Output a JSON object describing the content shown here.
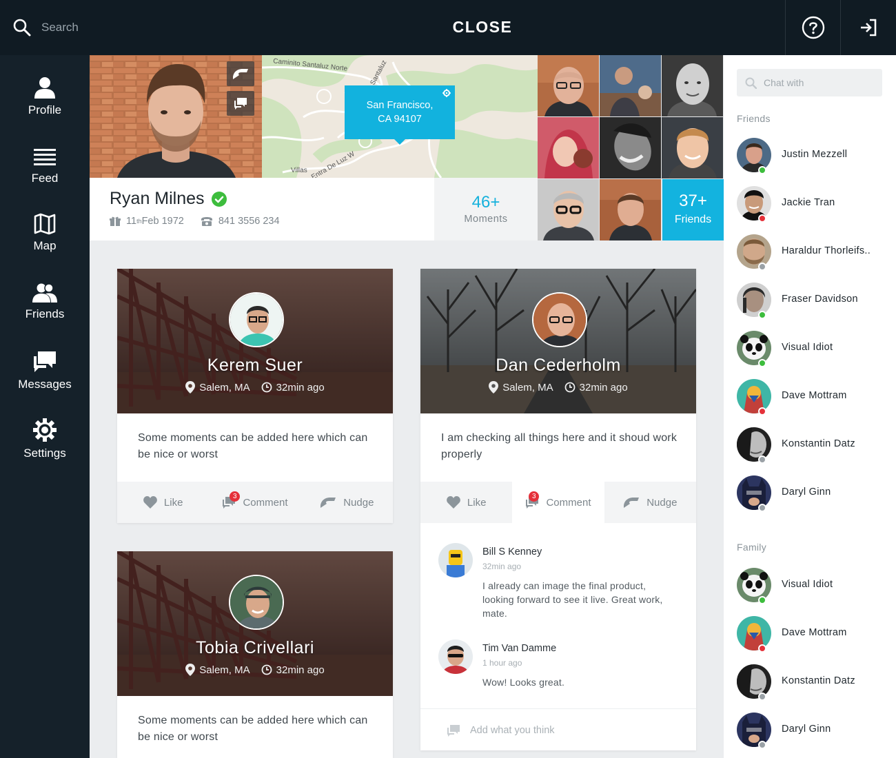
{
  "topbar": {
    "search_placeholder": "Search",
    "title": "CLOSE",
    "help_icon": "question-circle-icon",
    "logout_icon": "sign-out-icon"
  },
  "sidebar": {
    "items": [
      {
        "label": "Profile",
        "icon": "user-icon"
      },
      {
        "label": "Feed",
        "icon": "list-icon"
      },
      {
        "label": "Map",
        "icon": "map-icon"
      },
      {
        "label": "Friends",
        "icon": "users-icon"
      },
      {
        "label": "Messages",
        "icon": "chat-icon"
      },
      {
        "label": "Settings",
        "icon": "gear-icon"
      }
    ]
  },
  "map": {
    "location_line1": "San Francisco,",
    "location_line2": "CA 94107",
    "street_labels": [
      "Caminito Santaluz Norte",
      "Santaluz",
      "Villas",
      "Entra De Luz W"
    ]
  },
  "profile": {
    "name": "Ryan Milnes",
    "birthday_day": "11",
    "birthday_suffix": "th",
    "birthday_rest": " Feb 1972",
    "phone": "841 3556 234",
    "moments_count": "46+",
    "moments_label": "Moments",
    "friends_count": "37+",
    "friends_label": "Friends"
  },
  "cards": [
    {
      "name": "Kerem Suer",
      "location": "Salem, MA",
      "time": "32min ago",
      "text": "Some moments can be added here which can be nice or worst",
      "actions": {
        "like": "Like",
        "comment": "Comment",
        "comment_count": "3",
        "nudge": "Nudge"
      }
    },
    {
      "name": "Dan Cederholm",
      "location": "Salem, MA",
      "time": "32min ago",
      "text": "I am checking all things here and it shoud work properly",
      "actions": {
        "like": "Like",
        "comment": "Comment",
        "comment_count": "3",
        "nudge": "Nudge"
      },
      "comments": [
        {
          "name": "Bill S Kenney",
          "time": "32min ago",
          "text": "I already can image the final product, looking forward to see it live. Great work, mate."
        },
        {
          "name": "Tim Van Damme",
          "time": "1 hour ago",
          "text": "Wow! Looks great."
        }
      ],
      "add_placeholder": "Add what you think"
    },
    {
      "name": "Tobia Crivellari",
      "location": "Salem, MA",
      "time": "32min ago",
      "text": "Some moments can be added here which can be nice or worst"
    }
  ],
  "chat": {
    "search_placeholder": "Chat with",
    "friends_label": "Friends",
    "family_label": "Family",
    "friends": [
      {
        "name": "Justin Mezzell",
        "status": "online"
      },
      {
        "name": "Jackie Tran",
        "status": "busy"
      },
      {
        "name": "Haraldur Thorleifs..",
        "status": "offline"
      },
      {
        "name": "Fraser Davidson",
        "status": "online"
      },
      {
        "name": "Visual Idiot",
        "status": "online"
      },
      {
        "name": "Dave Mottram",
        "status": "busy"
      },
      {
        "name": "Konstantin Datz",
        "status": "offline"
      },
      {
        "name": "Daryl Ginn",
        "status": "offline"
      }
    ],
    "family": [
      {
        "name": "Visual Idiot",
        "status": "online"
      },
      {
        "name": "Dave Mottram",
        "status": "busy"
      },
      {
        "name": "Konstantin Datz",
        "status": "offline"
      },
      {
        "name": "Daryl Ginn",
        "status": "offline"
      }
    ]
  },
  "colors": {
    "accent": "#13b3df",
    "sidebar_bg": "#15212a",
    "topbar_bg": "#101b23",
    "online": "#3dbd3d",
    "busy": "#e5313a",
    "offline": "#9aa1a6",
    "verified": "#3dbd3d"
  }
}
